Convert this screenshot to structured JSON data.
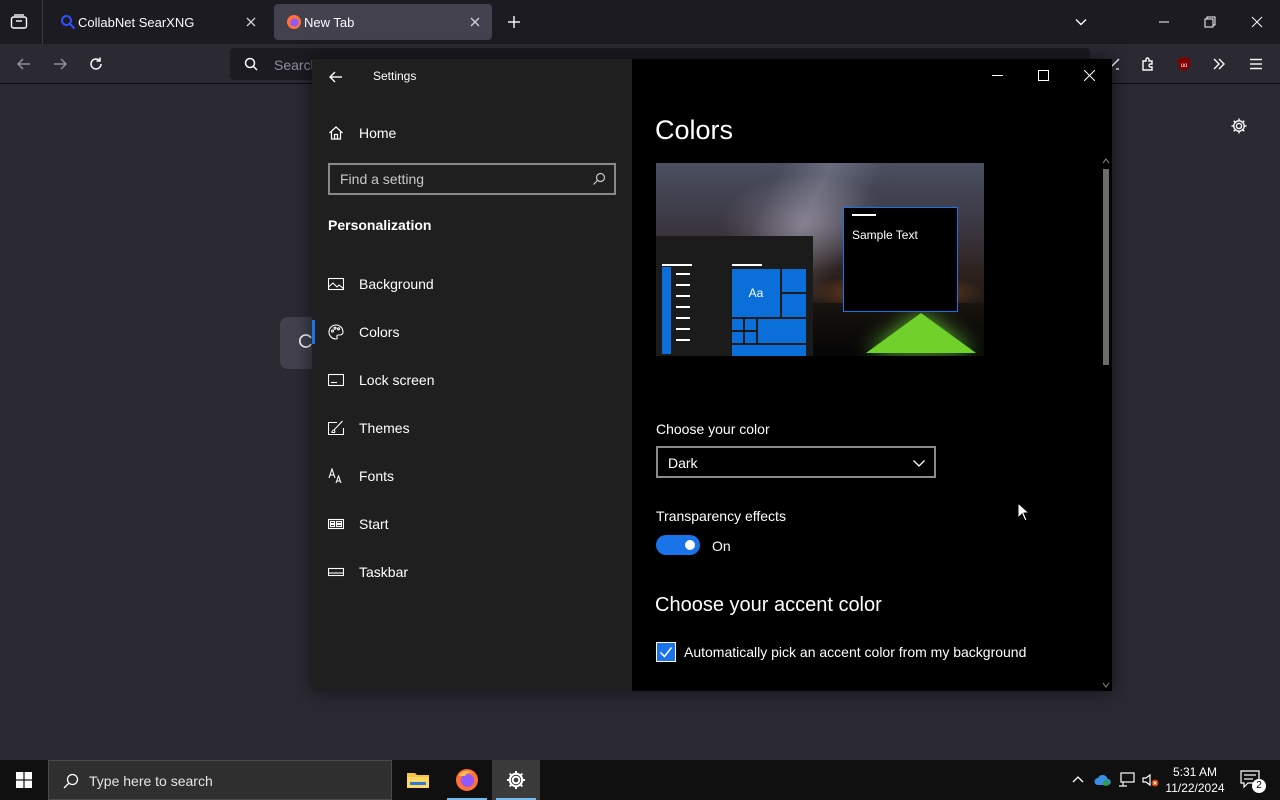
{
  "browser": {
    "tabs": [
      {
        "title": "CollabNet SearXNG",
        "active": false
      },
      {
        "title": "New Tab",
        "active": true
      }
    ],
    "urlbar": {
      "placeholder": "Search"
    }
  },
  "settings": {
    "window_title": "Settings",
    "home_label": "Home",
    "search": {
      "placeholder": "Find a setting"
    },
    "section_title": "Personalization",
    "nav_items": [
      {
        "label": "Background",
        "icon": "picture-icon"
      },
      {
        "label": "Colors",
        "icon": "palette-icon",
        "selected": true
      },
      {
        "label": "Lock screen",
        "icon": "lock-screen-icon"
      },
      {
        "label": "Themes",
        "icon": "themes-brush-icon"
      },
      {
        "label": "Fonts",
        "icon": "fonts-icon"
      },
      {
        "label": "Start",
        "icon": "start-tiles-icon"
      },
      {
        "label": "Taskbar",
        "icon": "taskbar-icon"
      }
    ],
    "page_title": "Colors",
    "preview": {
      "sample_text": "Sample Text",
      "tile_text": "Aa"
    },
    "choose_color": {
      "label": "Choose your color",
      "value": "Dark"
    },
    "transparency": {
      "label": "Transparency effects",
      "state": "On",
      "enabled": true
    },
    "accent": {
      "title": "Choose your accent color",
      "auto_pick_label": "Automatically pick an accent color from my background",
      "auto_pick_checked": true
    }
  },
  "taskbar": {
    "search_placeholder": "Type here to search",
    "time": "5:31 AM",
    "date": "11/22/2024",
    "notification_count": "2"
  },
  "colors": {
    "accent": "#1a73e8",
    "settings_nav_bg": "#1f1f1f",
    "settings_content_bg": "#000000",
    "browser_bg": "#2b2a33"
  }
}
